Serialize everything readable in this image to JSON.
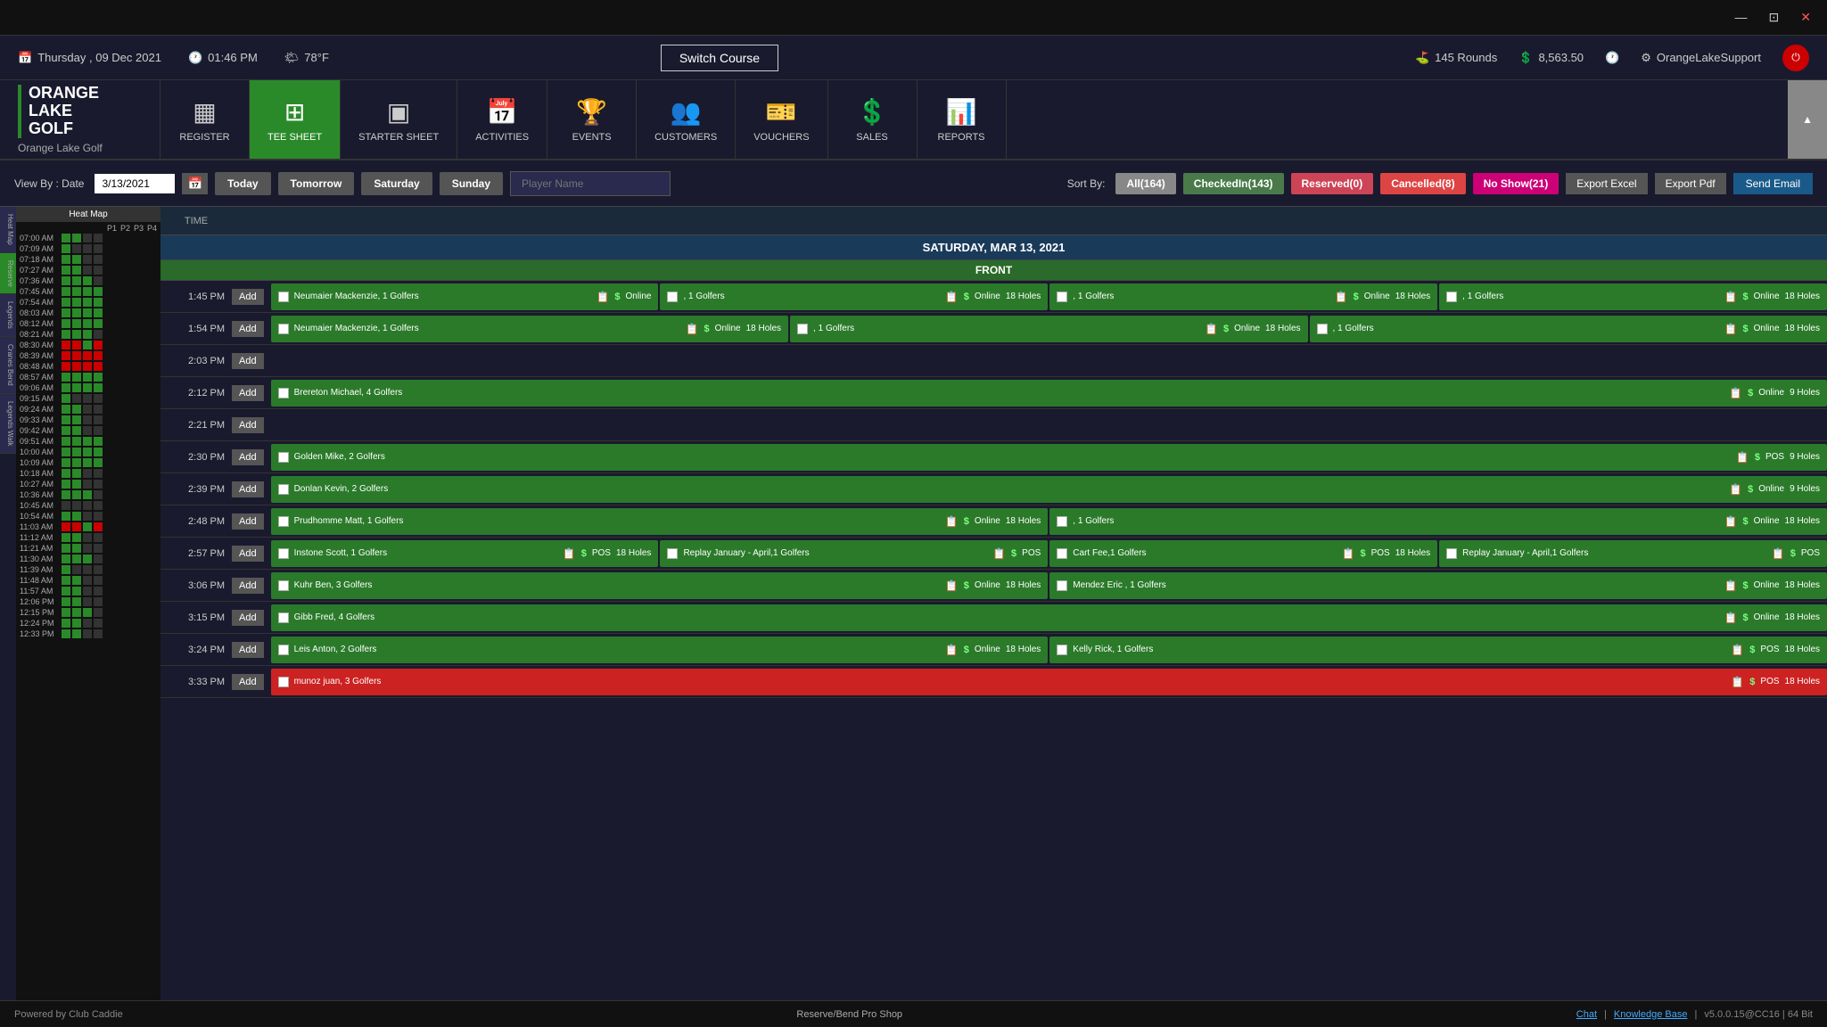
{
  "titleBar": {
    "minimize": "—",
    "restore": "⊡",
    "close": "✕"
  },
  "statusBar": {
    "date": "Thursday ,  09 Dec 2021",
    "time": "01:46 PM",
    "weather": "78°F",
    "switchCourse": "Switch Course",
    "rounds": "145 Rounds",
    "revenue": "8,563.50",
    "username": "OrangeLakeSupport"
  },
  "nav": {
    "items": [
      {
        "id": "register",
        "label": "REGISTER",
        "icon": "▦"
      },
      {
        "id": "tee-sheet",
        "label": "TEE SHEET",
        "icon": "⊞",
        "active": true
      },
      {
        "id": "starter-sheet",
        "label": "STARTER SHEET",
        "icon": "▣"
      },
      {
        "id": "activities",
        "label": "ACTIVITIES",
        "icon": "📅"
      },
      {
        "id": "events",
        "label": "EVENTS",
        "icon": "🏆"
      },
      {
        "id": "customers",
        "label": "CUSTOMERS",
        "icon": "👥"
      },
      {
        "id": "vouchers",
        "label": "VOUCHERS",
        "icon": "🎫"
      },
      {
        "id": "sales",
        "label": "SALES",
        "icon": "💲"
      },
      {
        "id": "reports",
        "label": "REPORTS",
        "icon": "📊"
      }
    ],
    "logoLine1": "ORANGE",
    "logoLine2": "LAKE",
    "logoLine3": "GOLF",
    "logoSubtitle": "Orange Lake Golf"
  },
  "filterBar": {
    "viewByLabel": "View By : Date",
    "dateValue": "3/13/2021",
    "todayLabel": "Today",
    "tomorrowLabel": "Tomorrow",
    "saturdayLabel": "Saturday",
    "sundayLabel": "Sunday",
    "playerNamePlaceholder": "Player Name",
    "sortByLabel": "Sort By:",
    "sortButtons": [
      {
        "id": "all",
        "label": "All(164)",
        "style": "all"
      },
      {
        "id": "checked",
        "label": "CheckedIn(143)",
        "style": "checked"
      },
      {
        "id": "reserved",
        "label": "Reserved(0)",
        "style": "reserved"
      },
      {
        "id": "cancelled",
        "label": "Cancelled(8)",
        "style": "cancelled"
      },
      {
        "id": "noshow",
        "label": "No Show(21)",
        "style": "noshow"
      }
    ],
    "exportExcel": "Export Excel",
    "exportPdf": "Export Pdf",
    "sendEmail": "Send Email"
  },
  "teeSheet": {
    "dateHeader": "SATURDAY, MAR 13, 2021",
    "frontLabel": "FRONT",
    "colHeader": "TIME",
    "rows": [
      {
        "time": "1:45 PM",
        "slots": [
          {
            "name": "Neumaier Mackenzie, 1 Golfers",
            "type": "Online",
            "holes": "",
            "color": "green"
          },
          {
            "name": ", 1 Golfers",
            "type": "Online",
            "holes": "18 Holes",
            "color": "green"
          },
          {
            "name": ", 1 Golfers",
            "type": "Online",
            "holes": "18 Holes",
            "color": "green"
          },
          {
            "name": ", 1 Golfers",
            "type": "Online",
            "holes": "18 Holes",
            "color": "green"
          }
        ]
      },
      {
        "time": "1:54 PM",
        "slots": [
          {
            "name": "Neumaier Mackenzie, 1 Golfers",
            "type": "Online",
            "holes": "18 Holes",
            "color": "green"
          },
          {
            "name": ", 1 Golfers",
            "type": "Online",
            "holes": "18 Holes",
            "color": "green"
          },
          {
            "name": ", 1 Golfers",
            "type": "Online",
            "holes": "18 Holes",
            "color": "green"
          }
        ]
      },
      {
        "time": "2:03 PM",
        "slots": []
      },
      {
        "time": "2:12 PM",
        "slots": [
          {
            "name": "Brereton  Michael, 4 Golfers",
            "type": "Online",
            "holes": "9 Holes",
            "color": "green"
          }
        ]
      },
      {
        "time": "2:21 PM",
        "slots": []
      },
      {
        "time": "2:30 PM",
        "slots": [
          {
            "name": "Golden Mike, 2 Golfers",
            "type": "POS",
            "holes": "9 Holes",
            "color": "green"
          }
        ]
      },
      {
        "time": "2:39 PM",
        "slots": [
          {
            "name": "Donlan Kevin, 2 Golfers",
            "type": "Online",
            "holes": "9 Holes",
            "color": "green"
          }
        ]
      },
      {
        "time": "2:48 PM",
        "slots": [
          {
            "name": "Prudhomme Matt, 1 Golfers",
            "type": "Online",
            "holes": "18 Holes",
            "color": "green"
          },
          {
            "name": ", 1 Golfers",
            "type": "Online",
            "holes": "18 Holes",
            "color": "green"
          }
        ]
      },
      {
        "time": "2:57 PM",
        "slots": [
          {
            "name": "Instone Scott, 1 Golfers",
            "type": "POS",
            "holes": "18 Holes",
            "color": "green"
          },
          {
            "name": "Replay January - April,1 Golfers",
            "type": "POS",
            "holes": "",
            "color": "green"
          },
          {
            "name": "Cart Fee,1 Golfers",
            "type": "POS",
            "holes": "18 Holes",
            "color": "green"
          },
          {
            "name": "Replay January - April,1 Golfers",
            "type": "POS",
            "holes": "",
            "color": "green"
          }
        ]
      },
      {
        "time": "3:06 PM",
        "slots": [
          {
            "name": "Kuhr Ben, 3 Golfers",
            "type": "Online",
            "holes": "18 Holes",
            "color": "green"
          },
          {
            "name": "Mendez Eric , 1 Golfers",
            "type": "Online",
            "holes": "18 Holes",
            "color": "green"
          }
        ]
      },
      {
        "time": "3:15 PM",
        "slots": [
          {
            "name": "Gibb Fred, 4 Golfers",
            "type": "Online",
            "holes": "18 Holes",
            "color": "green"
          }
        ]
      },
      {
        "time": "3:24 PM",
        "slots": [
          {
            "name": "Leis Anton, 2 Golfers",
            "type": "Online",
            "holes": "18 Holes",
            "color": "green"
          },
          {
            "name": "Kelly Rick, 1 Golfers",
            "type": "POS",
            "holes": "18 Holes",
            "color": "green"
          }
        ]
      },
      {
        "time": "3:33 PM",
        "slots": [
          {
            "name": "munoz juan, 3 Golfers",
            "type": "POS",
            "holes": "18 Holes",
            "color": "red"
          }
        ]
      }
    ]
  },
  "sidebar": {
    "heatMapLabel": "Heat Map",
    "columns": [
      "P1",
      "P2",
      "P3",
      "P4"
    ],
    "tabs": [
      "Heat Map",
      "Reserve",
      "Legends",
      "Cranes Bend",
      "Legends Walk"
    ],
    "times": [
      "07:00 AM",
      "07:09 AM",
      "07:18 AM",
      "07:27 AM",
      "07:36 AM",
      "07:45 AM",
      "07:54 AM",
      "08:03 AM",
      "08:12 AM",
      "08:21 AM",
      "08:30 AM",
      "08:39 AM",
      "08:48 AM",
      "08:57 AM",
      "09:06 AM",
      "09:15 AM",
      "09:24 AM",
      "09:33 AM",
      "09:42 AM",
      "09:51 AM",
      "10:00 AM",
      "10:09 AM",
      "10:18 AM",
      "10:27 AM",
      "10:36 AM",
      "10:45 AM",
      "10:54 AM",
      "11:03 AM",
      "11:12 AM",
      "11:21 AM",
      "11:30 AM",
      "11:39 AM",
      "11:48 AM",
      "11:57 AM",
      "12:06 PM",
      "12:15 PM",
      "12:24 PM",
      "12:33 PM"
    ]
  },
  "footer": {
    "poweredBy": "Powered by Club Caddie",
    "shopName": "Reserve/Bend Pro Shop",
    "chat": "Chat",
    "knowledgeBase": "Knowledge Base",
    "version": "v5.0.0.15@CC16  |  64 Bit"
  }
}
